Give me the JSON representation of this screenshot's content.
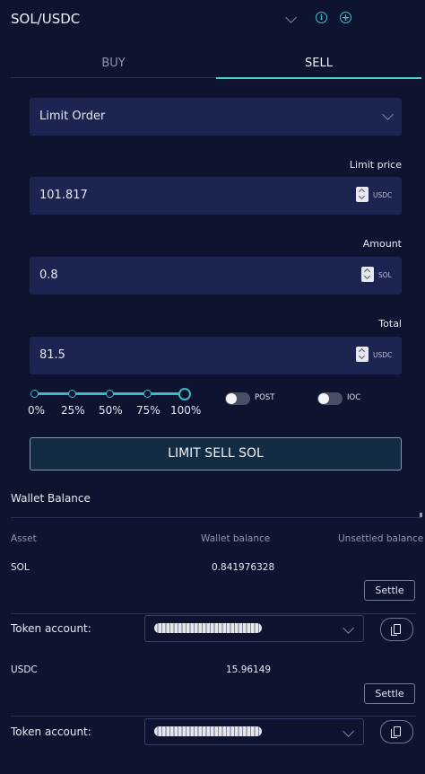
{
  "market": {
    "title": "SOL/USDC"
  },
  "tabs": [
    {
      "label": "BUY",
      "active": false
    },
    {
      "label": "SELL",
      "active": true
    }
  ],
  "order_type": {
    "selected": "Limit Order"
  },
  "limit_price": {
    "label": "Limit price",
    "value": "101.817",
    "unit": "USDC"
  },
  "amount": {
    "label": "Amount",
    "value": "0.8",
    "unit": "SOL"
  },
  "total": {
    "label": "Total",
    "value": "81.5",
    "unit": "USDC"
  },
  "slider": {
    "steps": [
      "0%",
      "25%",
      "50%",
      "75%",
      "100%"
    ],
    "value_percent": 100
  },
  "toggles": {
    "post": {
      "label": "POST",
      "on": false
    },
    "ioc": {
      "label": "IOC",
      "on": false
    }
  },
  "submit": {
    "label": "LIMIT SELL SOL"
  },
  "wallet": {
    "title": "Wallet Balance",
    "columns": [
      "Asset",
      "Wallet balance",
      "Unsettled balance"
    ],
    "assets": [
      {
        "asset": "SOL",
        "balance": "0.841976328",
        "settle_label": "Settle",
        "token_label": "Token account:"
      },
      {
        "asset": "USDC",
        "balance": "15.96149",
        "settle_label": "Settle",
        "token_label": "Token account:"
      }
    ]
  },
  "colors": {
    "background": "#0e1330",
    "field": "#1c2552",
    "accent": "#4ed3c8"
  }
}
